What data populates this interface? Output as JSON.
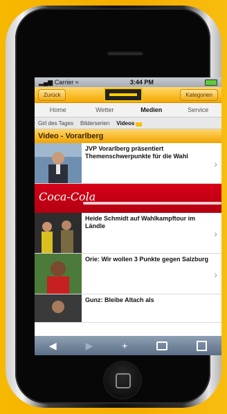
{
  "status": {
    "carrier": "Carrier",
    "time": "3:44 PM"
  },
  "nav": {
    "back_label": "Zurück",
    "categories_label": "Kategorien"
  },
  "tabs": [
    "Home",
    "Wetter",
    "Medien",
    "Service"
  ],
  "active_tab": "Medien",
  "subtabs": [
    "Girl des Tages",
    "Bilderserien",
    "Videos"
  ],
  "active_subtab": "Videos",
  "section_title": "Video - Vorarlberg",
  "items": [
    {
      "title": "JVP Vorarlberg präsentiert Themenschwerpunkte für die Wahl"
    },
    {
      "title": "Heide Schmidt auf Wahlkampftour im Ländle"
    },
    {
      "title": "Orie: Wir wollen 3 Punkte gegen Salzburg"
    },
    {
      "title": "Gunz: Bleibe Altach als"
    }
  ],
  "ad": {
    "brand": "Coca-Cola"
  },
  "toolbar": {
    "back": "◀",
    "forward": "▶",
    "add": "+"
  },
  "colors": {
    "accent": "#f4a800",
    "background": "#f6b400",
    "ad_red": "#d60018"
  }
}
